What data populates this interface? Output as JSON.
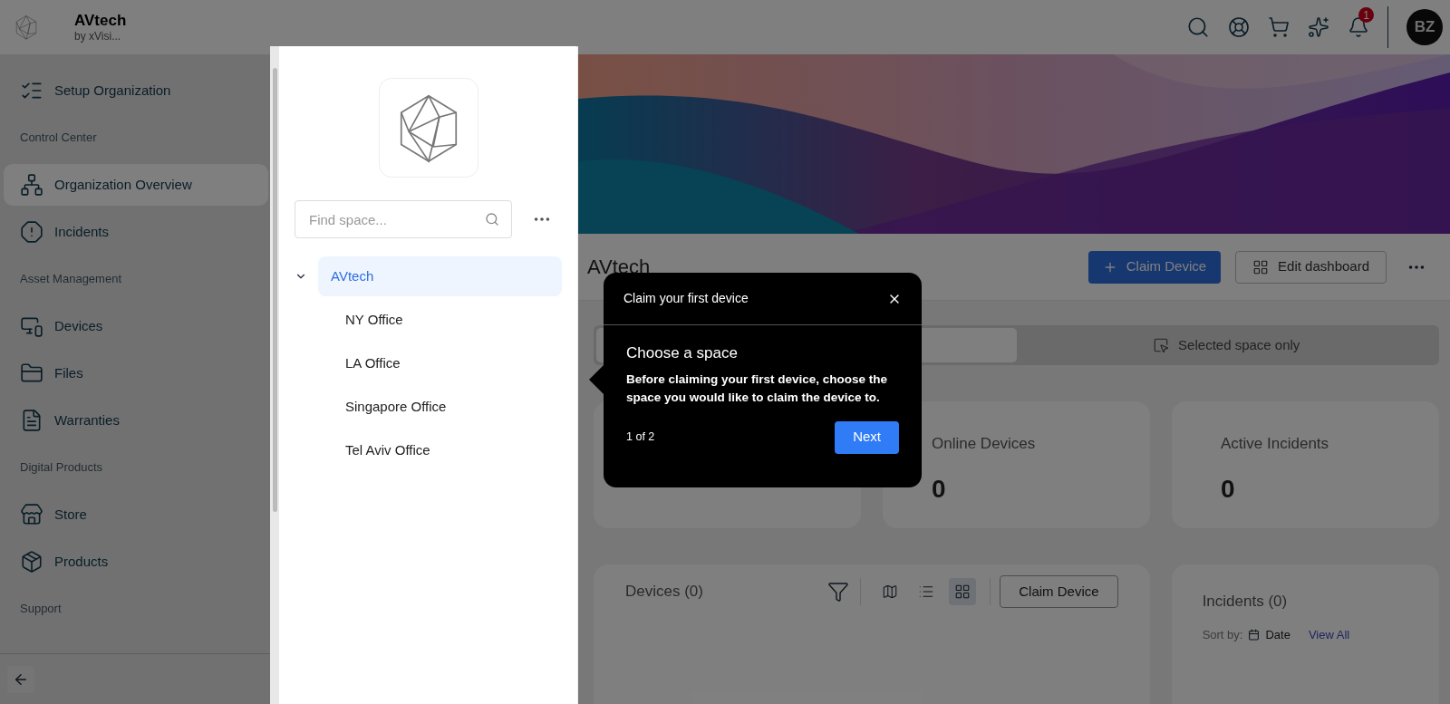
{
  "app": {
    "name": "AVtech",
    "subtitle": "by xVisi..."
  },
  "header": {
    "notification_count": "1",
    "avatar_initials": "BZ"
  },
  "sidebar": {
    "items": [
      {
        "kind": "item",
        "label": "Setup Organization",
        "selected": false
      },
      {
        "kind": "section",
        "label": "Control Center"
      },
      {
        "kind": "item",
        "label": "Organization Overview",
        "selected": true
      },
      {
        "kind": "item",
        "label": "Incidents",
        "selected": false
      },
      {
        "kind": "section",
        "label": "Asset Management"
      },
      {
        "kind": "item",
        "label": "Devices",
        "selected": false
      },
      {
        "kind": "item",
        "label": "Files",
        "selected": false
      },
      {
        "kind": "item",
        "label": "Warranties",
        "selected": false
      },
      {
        "kind": "section",
        "label": "Digital Products"
      },
      {
        "kind": "item",
        "label": "Store",
        "selected": false
      },
      {
        "kind": "item",
        "label": "Products",
        "selected": false
      },
      {
        "kind": "section",
        "label": "Support"
      }
    ]
  },
  "space_panel": {
    "search": {
      "placeholder": "Find space..."
    },
    "tree": [
      {
        "label": "AVtech",
        "selected": true,
        "expanded": true,
        "children": [
          {
            "label": "NY Office",
            "selected": false
          },
          {
            "label": "LA Office",
            "selected": false
          },
          {
            "label": "Singapore Office",
            "selected": false
          },
          {
            "label": "Tel Aviv Office",
            "selected": false
          }
        ]
      }
    ]
  },
  "page": {
    "title": "AVtech",
    "primary_button": "Claim Device",
    "secondary_button": "Edit dashboard",
    "scope_tabs": [
      {
        "selected": true
      },
      {
        "label": "Selected space only",
        "selected": false
      }
    ],
    "stats": [
      {
        "title": "Online Devices",
        "value": "0"
      },
      {
        "title": "Active Incidents",
        "value": "0"
      }
    ],
    "devices_card": {
      "title": "Devices (0)",
      "views": [
        {
          "selected": false
        },
        {
          "selected": false
        },
        {
          "selected": true
        }
      ],
      "button": "Claim Device"
    },
    "incidents_card": {
      "title": "Incidents (0)",
      "sort_label": "Sort by:",
      "sort_value": "Date",
      "link": "View All"
    }
  },
  "tour": {
    "title": "Claim your first device",
    "heading": "Choose a space",
    "body": "Before claiming your first device, choose the space you would like to claim the device to.",
    "step": "1 of 2",
    "next": "Next"
  }
}
